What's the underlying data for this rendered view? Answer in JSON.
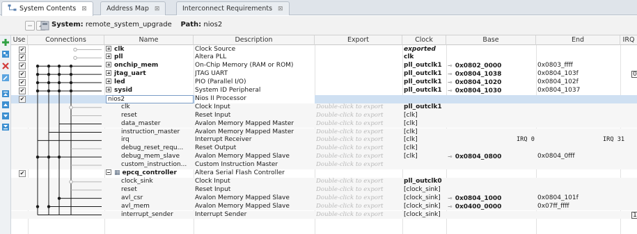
{
  "tabs": [
    {
      "label": "System Contents",
      "close": "⊠"
    },
    {
      "label": "Address Map",
      "close": "⊠"
    },
    {
      "label": "Interconnect Requirements",
      "close": "⊠"
    }
  ],
  "toolbar": {
    "system_label": "System:",
    "system_value": "remote_system_upgrade",
    "path_label": "Path:",
    "path_value": "nios2"
  },
  "columns": [
    "Use",
    "Connections",
    "Name",
    "Description",
    "Export",
    "Clock",
    "Base",
    "End",
    "IRQ"
  ],
  "rows": [
    {
      "use": true,
      "expander": "+",
      "name": "clk",
      "name_bold": true,
      "desc": "Clock Source",
      "export": "",
      "clock": "exported",
      "clock_style": "bold-italic",
      "base": "",
      "end": "",
      "irq": ""
    },
    {
      "use": true,
      "expander": "+",
      "name": "pll",
      "name_bold": true,
      "desc": "Altera PLL",
      "export": "",
      "clock": "clk",
      "clock_style": "bold",
      "base": "",
      "end": "",
      "irq": ""
    },
    {
      "use": true,
      "expander": "+",
      "name": "onchip_mem",
      "name_bold": true,
      "desc": "On-Chip Memory (RAM or ROM)",
      "export": "",
      "clock": "pll_outclk1",
      "clock_style": "bold",
      "base": "0x0802_0000",
      "end": "0x0803_ffff",
      "irq": ""
    },
    {
      "use": true,
      "expander": "+",
      "name": "jtag_uart",
      "name_bold": true,
      "desc": "JTAG UART",
      "export": "",
      "clock": "pll_outclk1",
      "clock_style": "bold",
      "base": "0x0804_1038",
      "end": "0x0804_103f",
      "irq": "0"
    },
    {
      "use": true,
      "expander": "+",
      "name": "led",
      "name_bold": true,
      "desc": "PIO (Parallel I/O)",
      "export": "",
      "clock": "pll_outclk1",
      "clock_style": "bold",
      "base": "0x0804_1020",
      "end": "0x0804_102f",
      "irq": ""
    },
    {
      "use": true,
      "expander": "+",
      "name": "sysid",
      "name_bold": true,
      "desc": "System ID Peripheral",
      "export": "",
      "clock": "pll_outclk1",
      "clock_style": "bold",
      "base": "0x0804_1030",
      "end": "0x0804_1037",
      "irq": ""
    },
    {
      "use": true,
      "expander": "",
      "name": "nios2",
      "name_bold": false,
      "desc": "Nios II Processor",
      "export": "",
      "clock": "",
      "clock_style": "",
      "base": "",
      "end": "",
      "irq": "",
      "selected": true
    },
    {
      "use": null,
      "indent": true,
      "name": "clk",
      "desc": "Clock Input",
      "export": "Double-click to export",
      "clock": "pll_outclk1",
      "clock_style": "bold",
      "base": "",
      "end": "",
      "irq": ""
    },
    {
      "use": null,
      "indent": true,
      "name": "reset",
      "desc": "Reset Input",
      "export": "Double-click to export",
      "clock": "[clk]",
      "clock_style": "",
      "base": "",
      "end": "",
      "irq": ""
    },
    {
      "use": null,
      "indent": true,
      "name": "data_master",
      "desc": "Avalon Memory Mapped Master",
      "export": "Double-click to export",
      "clock": "[clk]",
      "clock_style": "",
      "base": "",
      "end": "",
      "irq": ""
    },
    {
      "use": null,
      "indent": true,
      "name": "instruction_master",
      "desc": "Avalon Memory Mapped Master",
      "export": "Double-click to export",
      "clock": "[clk]",
      "clock_style": "",
      "base": "",
      "end": "",
      "irq": ""
    },
    {
      "use": null,
      "indent": true,
      "name": "irq",
      "desc": "Interrupt Receiver",
      "export": "Double-click to export",
      "clock": "[clk]",
      "clock_style": "",
      "base": "IRQ 0",
      "end": "IRQ 31",
      "irq": ""
    },
    {
      "use": null,
      "indent": true,
      "name": "debug_reset_requ...",
      "desc": "Reset Output",
      "export": "Double-click to export",
      "clock": "[clk]",
      "clock_style": "",
      "base": "",
      "end": "",
      "irq": ""
    },
    {
      "use": null,
      "indent": true,
      "name": "debug_mem_slave",
      "desc": "Avalon Memory Mapped Slave",
      "export": "Double-click to export",
      "clock": "[clk]",
      "clock_style": "",
      "base": "0x0804_0800",
      "end": "0x0804_0fff",
      "irq": ""
    },
    {
      "use": null,
      "indent": true,
      "name": "custom_instruction...",
      "desc": "Custom Instruction Master",
      "export": "Double-click to export",
      "clock": "",
      "clock_style": "",
      "base": "",
      "end": "",
      "irq": ""
    },
    {
      "use": true,
      "expander": "-",
      "name": "epcq_controller",
      "name_bold": true,
      "desc": "Altera Serial Flash Controller",
      "export": "",
      "clock": "",
      "clock_style": "",
      "base": "",
      "end": "",
      "irq": ""
    },
    {
      "use": null,
      "indent": true,
      "name": "clock_sink",
      "desc": "Clock Input",
      "export": "Double-click to export",
      "clock": "pll_outclk0",
      "clock_style": "bold",
      "base": "",
      "end": "",
      "irq": ""
    },
    {
      "use": null,
      "indent": true,
      "name": "reset",
      "desc": "Reset Input",
      "export": "Double-click to export",
      "clock": "[clock_sink]",
      "clock_style": "",
      "base": "",
      "end": "",
      "irq": ""
    },
    {
      "use": null,
      "indent": true,
      "name": "avl_csr",
      "desc": "Avalon Memory Mapped Slave",
      "export": "Double-click to export",
      "clock": "[clock_sink]",
      "clock_style": "",
      "base": "0x0804_1000",
      "end": "0x0804_101f",
      "irq": ""
    },
    {
      "use": null,
      "indent": true,
      "name": "avl_mem",
      "desc": "Avalon Memory Mapped Slave",
      "export": "Double-click to export",
      "clock": "[clock_sink]",
      "clock_style": "",
      "base": "0x0400_0000",
      "end": "0x07ff_ffff",
      "irq": ""
    },
    {
      "use": null,
      "indent": true,
      "name": "interrupt_sender",
      "desc": "Interrupt Sender",
      "export": "Double-click to export",
      "clock": "[clock_sink]",
      "clock_style": "",
      "base": "",
      "end": "",
      "irq": "1"
    }
  ],
  "colors": {
    "selection": "#cfe0f2",
    "header": "#f5f5f5",
    "ghost_text": "#b8b8b8"
  }
}
